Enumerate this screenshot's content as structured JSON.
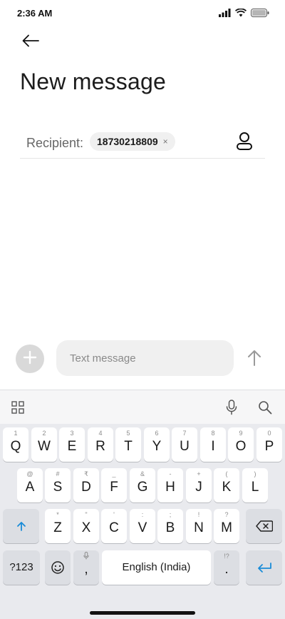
{
  "status_bar": {
    "time": "2:36 AM",
    "icons": [
      "signal-icon",
      "wifi-icon",
      "battery-icon"
    ]
  },
  "header": {
    "back_icon": "arrow-left-icon",
    "title": "New message"
  },
  "recipient": {
    "label": "Recipient:",
    "chips": [
      {
        "number": "18730218809",
        "remove_glyph": "×"
      }
    ],
    "contact_icon": "person-icon"
  },
  "compose": {
    "attach_icon": "plus-icon",
    "placeholder": "Text message",
    "value": "",
    "send_icon": "arrow-up-icon"
  },
  "keyboard": {
    "toolbar": [
      "grid-icon",
      "microphone-icon",
      "search-icon"
    ],
    "row1": [
      {
        "key": "Q",
        "hint": "1"
      },
      {
        "key": "W",
        "hint": "2"
      },
      {
        "key": "E",
        "hint": "3"
      },
      {
        "key": "R",
        "hint": "4"
      },
      {
        "key": "T",
        "hint": "5"
      },
      {
        "key": "Y",
        "hint": "6"
      },
      {
        "key": "U",
        "hint": "7"
      },
      {
        "key": "I",
        "hint": "8"
      },
      {
        "key": "O",
        "hint": "9"
      },
      {
        "key": "P",
        "hint": "0"
      }
    ],
    "row2": [
      {
        "key": "A",
        "hint": "@"
      },
      {
        "key": "S",
        "hint": "#"
      },
      {
        "key": "D",
        "hint": "₹"
      },
      {
        "key": "F",
        "hint": "_"
      },
      {
        "key": "G",
        "hint": "&"
      },
      {
        "key": "H",
        "hint": "-"
      },
      {
        "key": "J",
        "hint": "+"
      },
      {
        "key": "K",
        "hint": "("
      },
      {
        "key": "L",
        "hint": ")"
      }
    ],
    "row3": [
      {
        "key": "Z",
        "hint": "*"
      },
      {
        "key": "X",
        "hint": "\""
      },
      {
        "key": "C",
        "hint": "'"
      },
      {
        "key": "V",
        "hint": ":"
      },
      {
        "key": "B",
        "hint": ";"
      },
      {
        "key": "N",
        "hint": "!"
      },
      {
        "key": "M",
        "hint": "?"
      }
    ],
    "shift_icon": "shift-arrow-icon",
    "backspace_icon": "backspace-icon",
    "symbols_label": "?123",
    "emoji_icon": "emoji-icon",
    "comma": {
      "key": ",",
      "hint_icon": "microphone-icon"
    },
    "space_label": "English (India)",
    "period": {
      "key": ".",
      "hint": "!?"
    },
    "enter_icon": "enter-icon"
  },
  "colors": {
    "accent": "#1a8cd8",
    "keyboard_bg": "#e9eaee",
    "key_bg": "#ffffff",
    "input_bg": "#f0f0f0"
  }
}
